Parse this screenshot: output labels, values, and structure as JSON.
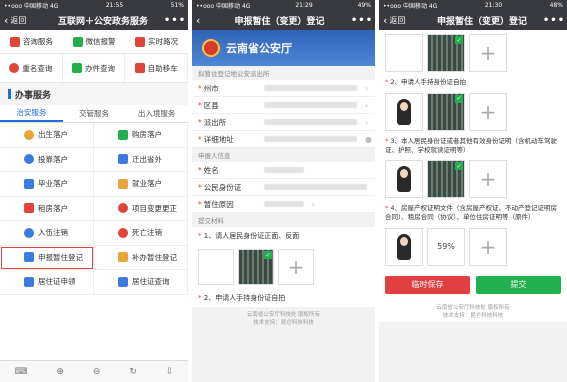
{
  "screen1": {
    "status": {
      "carrier": "••ooo 中国移动 4G",
      "time": "21:55",
      "battery": "51%"
    },
    "nav": {
      "back": "返回",
      "title": "互联网＋公安政务服务",
      "more": "•••"
    },
    "quick": [
      {
        "label": "咨询服务",
        "icon": "chat-icon"
      },
      {
        "label": "微信报警",
        "icon": "alarm-icon"
      },
      {
        "label": "实时路况",
        "icon": "road-icon"
      }
    ],
    "queries": [
      {
        "label": "重名查询",
        "icon": "name-search-icon"
      },
      {
        "label": "办件查询",
        "icon": "doc-search-icon"
      },
      {
        "label": "自助移车",
        "icon": "car-icon"
      }
    ],
    "section_title": "办事服务",
    "tabs": [
      "治安服务",
      "交管服务",
      "出入境服务"
    ],
    "services": [
      {
        "label": "出生落户",
        "icon": "baby-icon"
      },
      {
        "label": "购房落户",
        "icon": "building-icon"
      },
      {
        "label": "投靠落户",
        "icon": "people-icon"
      },
      {
        "label": "迁出省外",
        "icon": "move-out-icon"
      },
      {
        "label": "毕业落户",
        "icon": "graduate-icon"
      },
      {
        "label": "就业落户",
        "icon": "briefcase-icon"
      },
      {
        "label": "租房落户",
        "icon": "house-key-icon"
      },
      {
        "label": "项目变更更正",
        "icon": "person-edit-icon"
      },
      {
        "label": "入伍注销",
        "icon": "soldier-icon"
      },
      {
        "label": "死亡注销",
        "icon": "heart-icon"
      },
      {
        "label": "申报暂住登记",
        "icon": "home-icon"
      },
      {
        "label": "补办暂住登记",
        "icon": "puzzle-icon"
      },
      {
        "label": "居住证申领",
        "icon": "card-icon"
      },
      {
        "label": "居住证查询",
        "icon": "card-search-icon"
      }
    ]
  },
  "screen2": {
    "status": {
      "carrier": "••ooo 中国移动 4G",
      "time": "21:29",
      "battery": "49%"
    },
    "nav": {
      "back": "",
      "title": "申报暂住（变更）登记",
      "more": "•••"
    },
    "banner": "云南省公安厅",
    "group1": "拟暂住登记地公安派出所",
    "rows1": [
      {
        "label": "州市"
      },
      {
        "label": "区县"
      },
      {
        "label": "派出所"
      },
      {
        "label": "详细地址"
      }
    ],
    "group2": "申报人信息",
    "rows2": [
      {
        "label": "姓名"
      },
      {
        "label": "公民身份证"
      },
      {
        "label": "暂住原因"
      }
    ],
    "group3": "提交材料",
    "note1": "1、请人居民身份证正面、反面",
    "note2": "2、申请人手持身份证自拍",
    "footer1": "云南省公安厅科技处 版权所有",
    "footer2": "技术支持：昆仑科技科技"
  },
  "screen3": {
    "status": {
      "carrier": "••ooo 中国移动 4G",
      "time": "21:30",
      "battery": "48%"
    },
    "nav": {
      "back": "返回",
      "title": "申报暂住（变更）登记",
      "more": "•••"
    },
    "cap2": "2、申请人手持身份证自拍",
    "cap3": "3、本人居民身份证或者其他有效身份证明（含机动车驾驶证、护照、学校就读证明等）",
    "cap4": "4、房屋产权证明文件（含房屋产权证、不动产登记证明房合同）、租房合同（协议）、单位住房证明等（原件）",
    "percent": "59%",
    "save": "临时保存",
    "submit": "提交",
    "footer1": "云南省公安厅科技处 版权所有",
    "footer2": "技术支持：昆仑科技科技"
  }
}
